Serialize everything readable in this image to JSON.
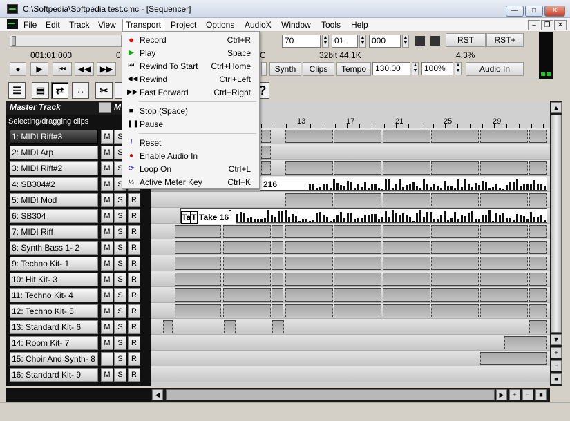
{
  "window": {
    "title": "C:\\Softpedia\\Softpedia test.cmc - [Sequencer]",
    "minimize": "—",
    "maximize": "□",
    "close": "✕"
  },
  "menubar": {
    "items": [
      "File",
      "Edit",
      "Track",
      "View",
      "Transport",
      "Project",
      "Options",
      "AudioX",
      "Window",
      "Tools",
      "Help"
    ],
    "active": "Transport",
    "mdi_minimize": "–",
    "mdi_restore": "❐",
    "mdi_close": "✕"
  },
  "transport": {
    "position": "001:01:000",
    "field_70": "70",
    "field_01": "01",
    "field_000": "000",
    "rst": "RST",
    "rst_plus": "RST+",
    "format": "32bit 44.1K",
    "cpu": "4.3%",
    "c_fragment": "C",
    "synth": "Synth",
    "clips": "Clips",
    "tempo_label": "Tempo",
    "tempo": "130.00",
    "zoom": "100%",
    "audio_in": "Audio In"
  },
  "transport_menu": [
    {
      "label": "Record",
      "shortcut": "Ctrl+R",
      "icon": "record-icon"
    },
    {
      "label": "Play",
      "shortcut": "Space",
      "icon": "play-icon"
    },
    {
      "label": "Rewind To Start",
      "shortcut": "Ctrl+Home",
      "icon": "rewind-start-icon"
    },
    {
      "label": "Rewind",
      "shortcut": "Ctrl+Left",
      "icon": "rewind-icon"
    },
    {
      "label": "Fast Forward",
      "shortcut": "Ctrl+Right",
      "icon": "fast-forward-icon"
    },
    {
      "label": "Stop (Space)",
      "shortcut": "",
      "icon": "stop-icon"
    },
    {
      "label": "Pause",
      "shortcut": "",
      "icon": "pause-icon"
    },
    {
      "label": "Reset",
      "shortcut": "",
      "icon": "reset-icon"
    },
    {
      "label": "Enable Audio In",
      "shortcut": "",
      "icon": "audio-in-icon"
    },
    {
      "label": "Loop On",
      "shortcut": "Ctrl+L",
      "icon": "loop-icon"
    },
    {
      "label": "Active Meter Key",
      "shortcut": "Ctrl+K",
      "icon": "meter-key-icon"
    }
  ],
  "master": {
    "label": "Master Track",
    "m_fragment": "M",
    "hint": "Selecting/dragging clips"
  },
  "tracks": [
    {
      "name": "1: MIDI Riff#3",
      "m": "M",
      "s": "S",
      "r": "R"
    },
    {
      "name": "2: MIDI Arp",
      "m": "M",
      "s": "S",
      "r": "R"
    },
    {
      "name": "3: MIDI Riff#2",
      "m": "M",
      "s": "S",
      "r": "R"
    },
    {
      "name": "4: SB304#2",
      "m": "M",
      "s": "S",
      "r": "R"
    },
    {
      "name": "5: MIDI Mod",
      "m": "M",
      "s": "S",
      "r": "R"
    },
    {
      "name": "6: SB304",
      "m": "M",
      "s": "S",
      "r": "R"
    },
    {
      "name": "7: MIDI Riff",
      "m": "M",
      "s": "S",
      "r": "R"
    },
    {
      "name": "8: Synth Bass 1- 2",
      "m": "M",
      "s": "S",
      "r": "R"
    },
    {
      "name": "9: Techno Kit- 1",
      "m": "M",
      "s": "S",
      "r": "R"
    },
    {
      "name": "10: Hit Kit- 3",
      "m": "M",
      "s": "S",
      "r": "R"
    },
    {
      "name": "11: Techno Kit- 4",
      "m": "M",
      "s": "S",
      "r": "R"
    },
    {
      "name": "12: Techno Kit- 5",
      "m": "M",
      "s": "S",
      "r": "R"
    },
    {
      "name": "13: Standard Kit- 6",
      "m": "M",
      "s": "S",
      "r": "R"
    },
    {
      "name": "14: Room Kit- 7",
      "m": "M",
      "s": "S",
      "r": "R"
    },
    {
      "name": "15: Choir And Synth- 8",
      "m": "",
      "s": "S",
      "r": "R"
    },
    {
      "name": "16: Standard Kit- 9",
      "m": "M",
      "s": "S",
      "r": "R"
    }
  ],
  "ruler": {
    "bars": [
      "13",
      "17",
      "21",
      "25",
      "29"
    ]
  },
  "clips": {
    "take_label": "Take 16",
    "take_partial": "Ta",
    "take_partial2": "T",
    "take4_partial": "216"
  },
  "scroll": {
    "up": "▲",
    "down": "▼",
    "left": "◀",
    "right": "▶",
    "plus": "+",
    "minus": "−",
    "square": "■"
  },
  "tools": {
    "help": "?"
  }
}
